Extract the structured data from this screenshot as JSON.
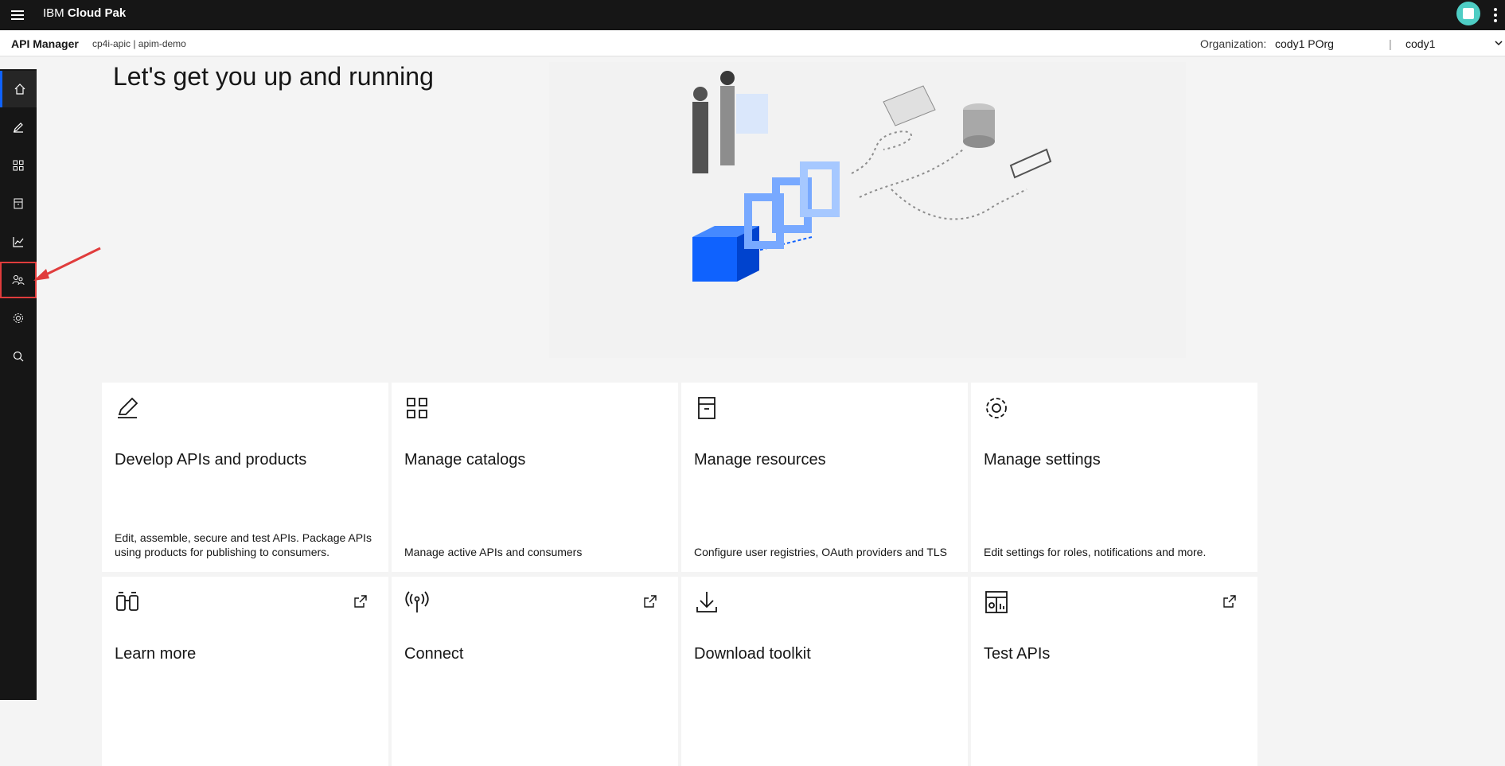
{
  "topbar": {
    "brand_prefix": "IBM",
    "brand_name": "Cloud Pak"
  },
  "subbar": {
    "app_name": "API Manager",
    "breadcrumb": "cp4i-apic  |  apim-demo",
    "org_label": "Organization:",
    "org_value": "cody1 POrg",
    "separator": "|",
    "user": "cody1"
  },
  "sidenav": {
    "items": [
      {
        "name": "home",
        "icon": "home-icon"
      },
      {
        "name": "develop",
        "icon": "pencil-icon"
      },
      {
        "name": "catalogs",
        "icon": "grid-icon"
      },
      {
        "name": "resources",
        "icon": "document-icon"
      },
      {
        "name": "analytics",
        "icon": "chart-icon"
      },
      {
        "name": "members",
        "icon": "user-group-icon"
      },
      {
        "name": "settings",
        "icon": "gear-icon"
      },
      {
        "name": "search",
        "icon": "search-icon"
      }
    ]
  },
  "main": {
    "welcome_title": "Let's get you up and running",
    "tiles": [
      {
        "title": "Develop APIs and products",
        "desc": "Edit, assemble, secure and test APIs. Package APIs using products for publishing to consumers.",
        "icon": "pencil-icon"
      },
      {
        "title": "Manage catalogs",
        "desc": "Manage active APIs and consumers",
        "icon": "grid-icon"
      },
      {
        "title": "Manage resources",
        "desc": "Configure user registries, OAuth providers and TLS",
        "icon": "document-icon"
      },
      {
        "title": "Manage settings",
        "desc": "Edit settings for roles, notifications and more.",
        "icon": "gear-icon"
      },
      {
        "title": "Learn more",
        "desc": "",
        "icon": "binoculars-icon",
        "external": true
      },
      {
        "title": "Connect",
        "desc": "",
        "icon": "antenna-icon",
        "external": true
      },
      {
        "title": "Download toolkit",
        "desc": "",
        "icon": "download-icon",
        "external": false
      },
      {
        "title": "Test APIs",
        "desc": "",
        "icon": "test-icon",
        "external": true
      }
    ]
  },
  "colors": {
    "accent": "#0f62fe",
    "highlight": "#e03c3c",
    "dark": "#161616"
  }
}
